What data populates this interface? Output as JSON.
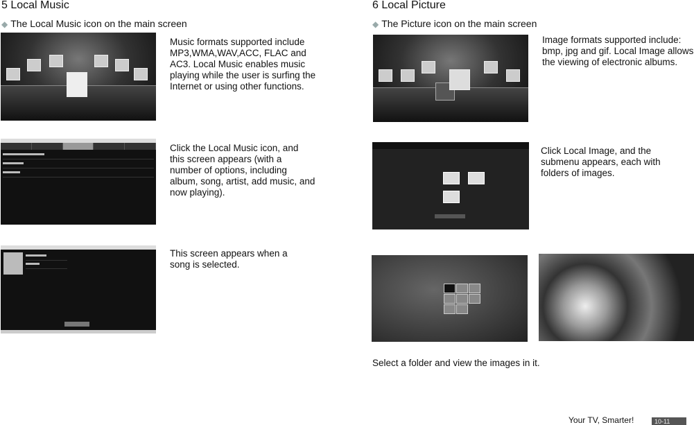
{
  "music": {
    "heading": "5 Local Music",
    "bullet": "The Local Music icon on the main screen",
    "text1": "Music formats supported include MP3,WMA,WAV,ACC, FLAC and AC3. Local Music enables music playing while the user is surfing the Internet or using other functions.",
    "text2": "Click the Local Music icon, and this screen appears (with a number of options, including album, song, artist, add music, and now playing).",
    "text3": "This screen appears when a song is selected."
  },
  "picture": {
    "heading": "6  Local Picture",
    "bullet": "The Picture icon on the main screen",
    "text1": "Image formats supported include: bmp, jpg and gif. Local Image allows the viewing of electronic albums.",
    "text2": "Click Local Image, and the submenu appears, each with folders of images.",
    "text3": "Select a folder and view the images in it."
  },
  "footer": {
    "slogan": "Your TV, Smarter!",
    "page": "10-11"
  },
  "icons": {
    "bullet": "diamond-icon"
  }
}
